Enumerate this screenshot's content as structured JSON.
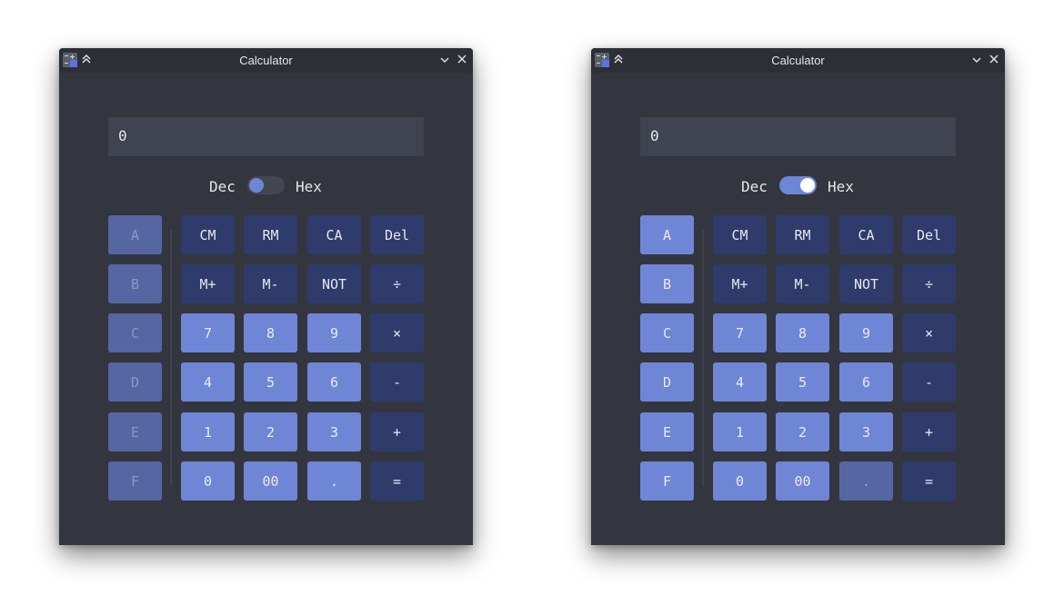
{
  "windows": [
    {
      "title": "Calculator",
      "display_value": "0",
      "mode": {
        "left_label": "Dec",
        "right_label": "Hex",
        "state": "Dec"
      },
      "hex_keys_enabled": false,
      "dot_enabled": true
    },
    {
      "title": "Calculator",
      "display_value": "0",
      "mode": {
        "left_label": "Dec",
        "right_label": "Hex",
        "state": "Hex"
      },
      "hex_keys_enabled": true,
      "dot_enabled": false
    }
  ],
  "keys": {
    "hex": [
      "A",
      "B",
      "C",
      "D",
      "E",
      "F"
    ],
    "rows": [
      [
        "CM",
        "RM",
        "CA",
        "Del"
      ],
      [
        "M+",
        "M-",
        "NOT",
        "÷"
      ],
      [
        "7",
        "8",
        "9",
        "×"
      ],
      [
        "4",
        "5",
        "6",
        "-"
      ],
      [
        "1",
        "2",
        "3",
        "+"
      ],
      [
        "0",
        "00",
        ".",
        "="
      ]
    ]
  },
  "icons": {
    "app": "calculator-app-icon",
    "keep_above": "double-chevron-up-icon",
    "minimize": "chevron-down-icon",
    "close": "close-icon"
  },
  "colors": {
    "window_bg": "#33363f",
    "titlebar_bg": "#2c2f36",
    "display_bg": "#404450",
    "key_dark": "#2f3b6b",
    "key_light": "#6f85d6",
    "key_disabled": "#5666a3",
    "accent": "#6d86d6"
  }
}
